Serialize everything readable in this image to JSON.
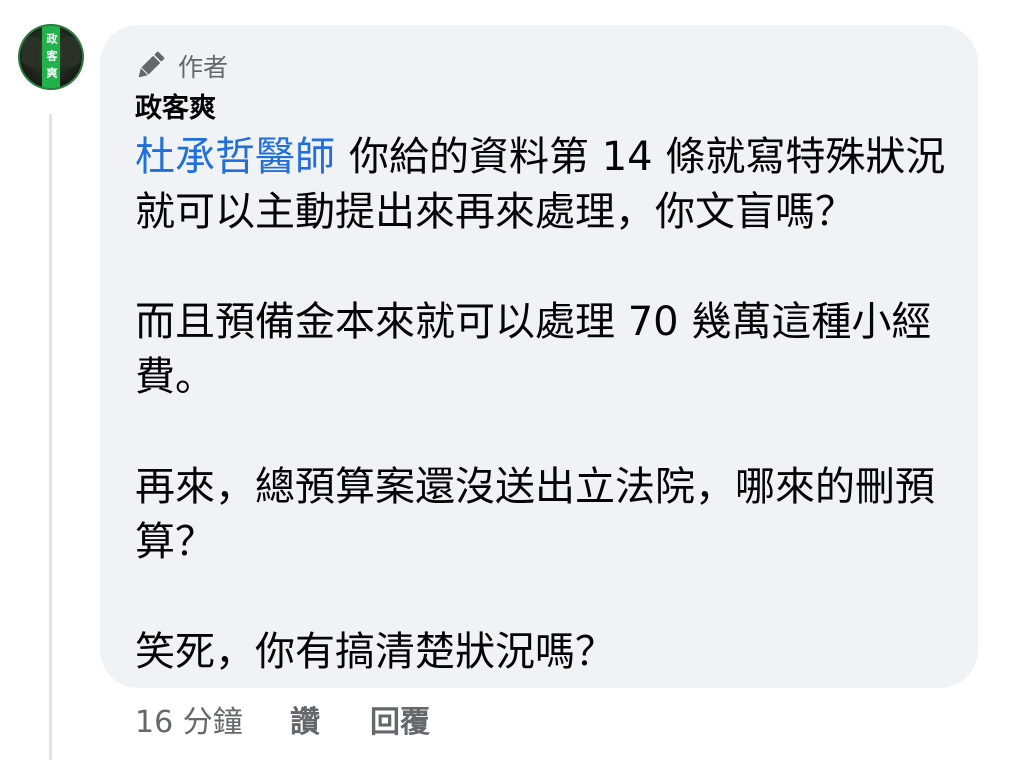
{
  "comment": {
    "avatar": {
      "icon": "profile-avatar",
      "logo_text": "政客爽"
    },
    "author_badge": {
      "icon": "pencil-icon",
      "label": "作者"
    },
    "author_name": "政客爽",
    "mention": "杜承哲醫師",
    "paragraphs": [
      [
        "你給的資料第 14 條就寫特殊狀況",
        "就可以主動提出來再來處理，你文盲嗎？"
      ],
      [
        "而且預備金本來就可以處理 70 幾萬這種小經",
        "費。"
      ],
      [
        "再來，總預算案還沒送出立法院，哪來的刪預",
        "算？"
      ],
      [
        "笑死，你有搞清楚狀況嗎？"
      ]
    ],
    "timestamp": "16 分鐘",
    "actions": {
      "like": "讚",
      "reply": "回覆"
    }
  },
  "colors": {
    "mention": "#216fdb",
    "bubble": "#f0f2f5",
    "secondary_text": "#65676b",
    "avatar_band": "#22b24c",
    "thread_line": "#e2e4e8"
  }
}
